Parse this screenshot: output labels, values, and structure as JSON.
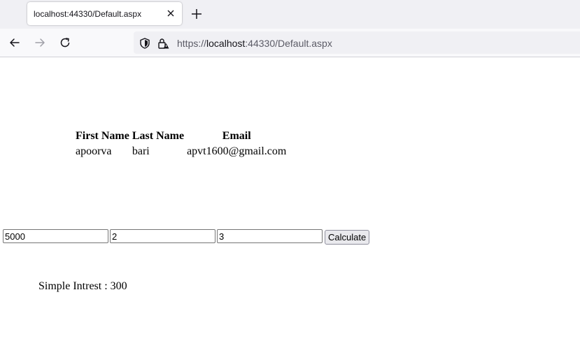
{
  "browser": {
    "tab_title": "localhost:44330/Default.aspx",
    "url_scheme": "https://",
    "url_host": "localhost",
    "url_rest": ":44330/Default.aspx"
  },
  "grid": {
    "headers": [
      "First Name",
      "Last Name",
      "Email"
    ],
    "rows": [
      [
        "apoorva",
        "bari",
        "apvt1600@gmail.com"
      ]
    ]
  },
  "form": {
    "principal_value": "5000",
    "rate_value": "2",
    "time_value": "3",
    "calculate_label": "Calculate"
  },
  "result": {
    "label": "Simple Intrest : ",
    "value": "300"
  }
}
